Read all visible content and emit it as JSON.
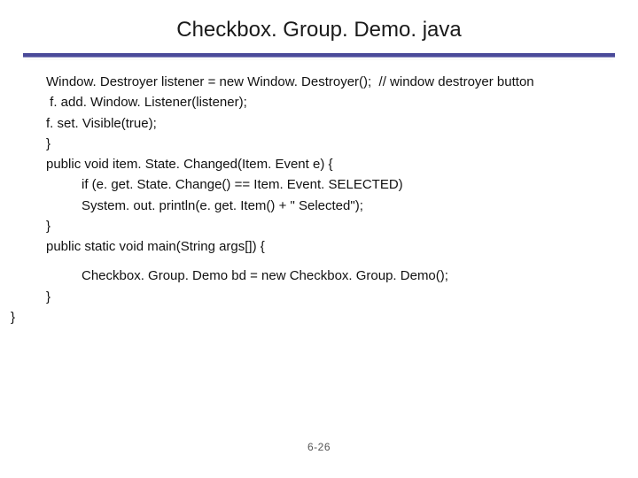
{
  "title": "Checkbox. Group. Demo. java",
  "code": {
    "l1": "Window. Destroyer listener = new Window. Destroyer();  // window destroyer button",
    "l2": " f. add. Window. Listener(listener);",
    "l3": "f. set. Visible(true);",
    "l4": "}",
    "l5": "public void item. State. Changed(Item. Event e) {",
    "l6": "if (e. get. State. Change() == Item. Event. SELECTED)",
    "l7": "System. out. println(e. get. Item() + \" Selected\");",
    "l8": "}",
    "l9": "public static void main(String args[]) {",
    "l10": "Checkbox. Group. Demo bd = new Checkbox. Group. Demo();",
    "l11": "}",
    "l12": "}"
  },
  "pagenum": "6-26"
}
